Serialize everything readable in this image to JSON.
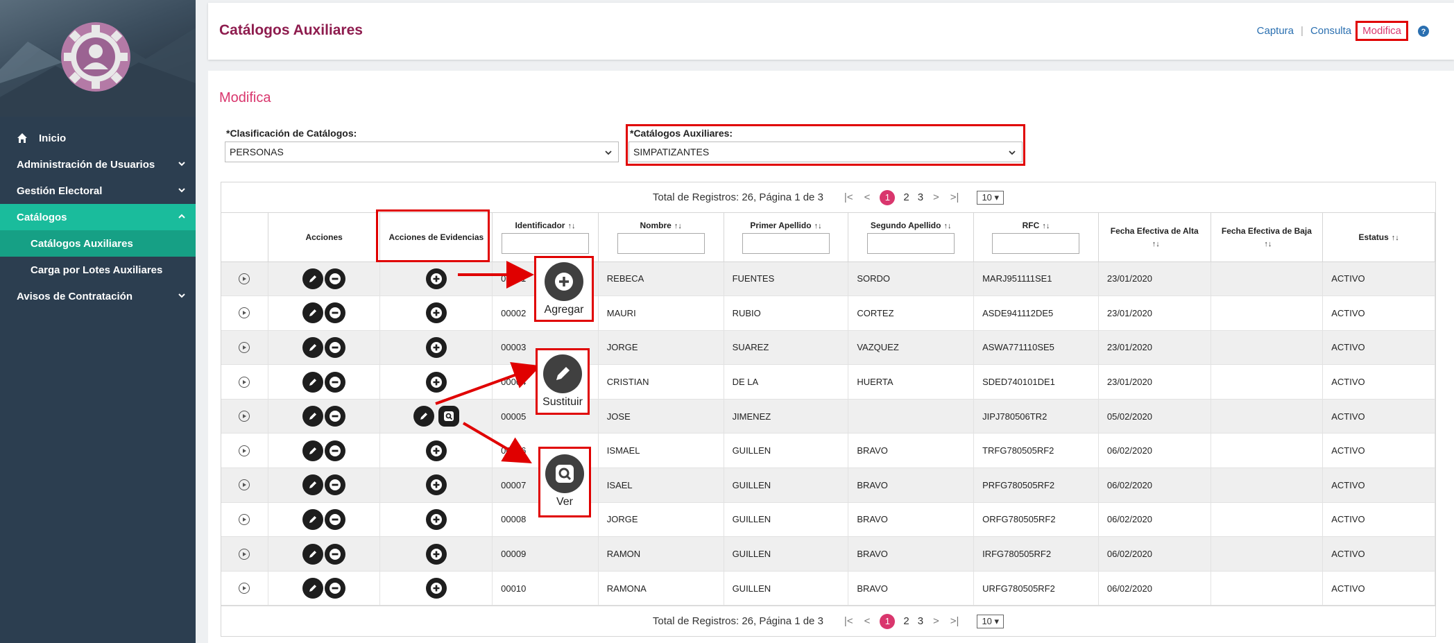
{
  "sidebar": {
    "items": [
      {
        "label": "Inicio"
      },
      {
        "label": "Administración de Usuarios"
      },
      {
        "label": "Gestión Electoral"
      },
      {
        "label": "Catálogos"
      },
      {
        "label": "Avisos de Contratación"
      }
    ],
    "sub_items": [
      {
        "label": "Catálogos Auxiliares"
      },
      {
        "label": "Carga por Lotes Auxiliares"
      }
    ],
    "colors": {
      "bg": "#2c3e50",
      "active": "#1abc9c"
    }
  },
  "header": {
    "title": "Catálogos Auxiliares",
    "links": {
      "captura": "Captura",
      "consulta": "Consulta",
      "modifica": "Modifica"
    }
  },
  "main": {
    "subtitle": "Modifica",
    "clasificacion": {
      "label": "*Clasificación de Catálogos:",
      "value": "PERSONAS"
    },
    "catalogos": {
      "label": "*Catálogos Auxiliares:",
      "value": "SIMPATIZANTES"
    }
  },
  "pager": {
    "summary": "Total de Registros: 26, Página 1 de 3",
    "pages": [
      "1",
      "2",
      "3"
    ],
    "page_size": "10"
  },
  "table": {
    "headers": {
      "acciones": "Acciones",
      "evidencias": "Acciones de Evidencias",
      "identificador": "Identificador",
      "nombre": "Nombre",
      "primer": "Primer Apellido",
      "segundo": "Segundo Apellido",
      "rfc": "RFC",
      "alta": "Fecha Efectiva de Alta",
      "baja": "Fecha Efectiva de Baja",
      "estatus": "Estatus"
    },
    "rows": [
      {
        "id": "00001",
        "nombre": "REBECA",
        "primer": "FUENTES",
        "segundo": "SORDO",
        "rfc": "MARJ951111SE1",
        "alta": "23/01/2020",
        "baja": "",
        "estatus": "ACTIVO",
        "evid": "add"
      },
      {
        "id": "00002",
        "nombre": "MAURI",
        "primer": "RUBIO",
        "segundo": "CORTEZ",
        "rfc": "ASDE941112DE5",
        "alta": "23/01/2020",
        "baja": "",
        "estatus": "ACTIVO",
        "evid": "add"
      },
      {
        "id": "00003",
        "nombre": "JORGE",
        "primer": "SUAREZ",
        "segundo": "VAZQUEZ",
        "rfc": "ASWA771110SE5",
        "alta": "23/01/2020",
        "baja": "",
        "estatus": "ACTIVO",
        "evid": "add"
      },
      {
        "id": "00004",
        "nombre": "CRISTIAN",
        "primer": "DE LA",
        "segundo": "HUERTA",
        "rfc": "SDED740101DE1",
        "alta": "23/01/2020",
        "baja": "",
        "estatus": "ACTIVO",
        "evid": "add"
      },
      {
        "id": "00005",
        "nombre": "JOSE",
        "primer": "JIMENEZ",
        "segundo": "",
        "rfc": "JIPJ780506TR2",
        "alta": "05/02/2020",
        "baja": "",
        "estatus": "ACTIVO",
        "evid": "edit-view"
      },
      {
        "id": "00006",
        "nombre": "ISMAEL",
        "primer": "GUILLEN",
        "segundo": "BRAVO",
        "rfc": "TRFG780505RF2",
        "alta": "06/02/2020",
        "baja": "",
        "estatus": "ACTIVO",
        "evid": "add"
      },
      {
        "id": "00007",
        "nombre": "ISAEL",
        "primer": "GUILLEN",
        "segundo": "BRAVO",
        "rfc": "PRFG780505RF2",
        "alta": "06/02/2020",
        "baja": "",
        "estatus": "ACTIVO",
        "evid": "add"
      },
      {
        "id": "00008",
        "nombre": "JORGE",
        "primer": "GUILLEN",
        "segundo": "BRAVO",
        "rfc": "ORFG780505RF2",
        "alta": "06/02/2020",
        "baja": "",
        "estatus": "ACTIVO",
        "evid": "add"
      },
      {
        "id": "00009",
        "nombre": "RAMON",
        "primer": "GUILLEN",
        "segundo": "BRAVO",
        "rfc": "IRFG780505RF2",
        "alta": "06/02/2020",
        "baja": "",
        "estatus": "ACTIVO",
        "evid": "add"
      },
      {
        "id": "00010",
        "nombre": "RAMONA",
        "primer": "GUILLEN",
        "segundo": "BRAVO",
        "rfc": "URFG780505RF2",
        "alta": "06/02/2020",
        "baja": "",
        "estatus": "ACTIVO",
        "evid": "add"
      }
    ]
  },
  "callouts": {
    "agregar": "Agregar",
    "sustituir": "Sustituir",
    "ver": "Ver"
  },
  "colors": {
    "title": "#8e1c4e",
    "accent": "#d9366d",
    "highlight": "#e00000",
    "link": "#2a6fb0"
  }
}
